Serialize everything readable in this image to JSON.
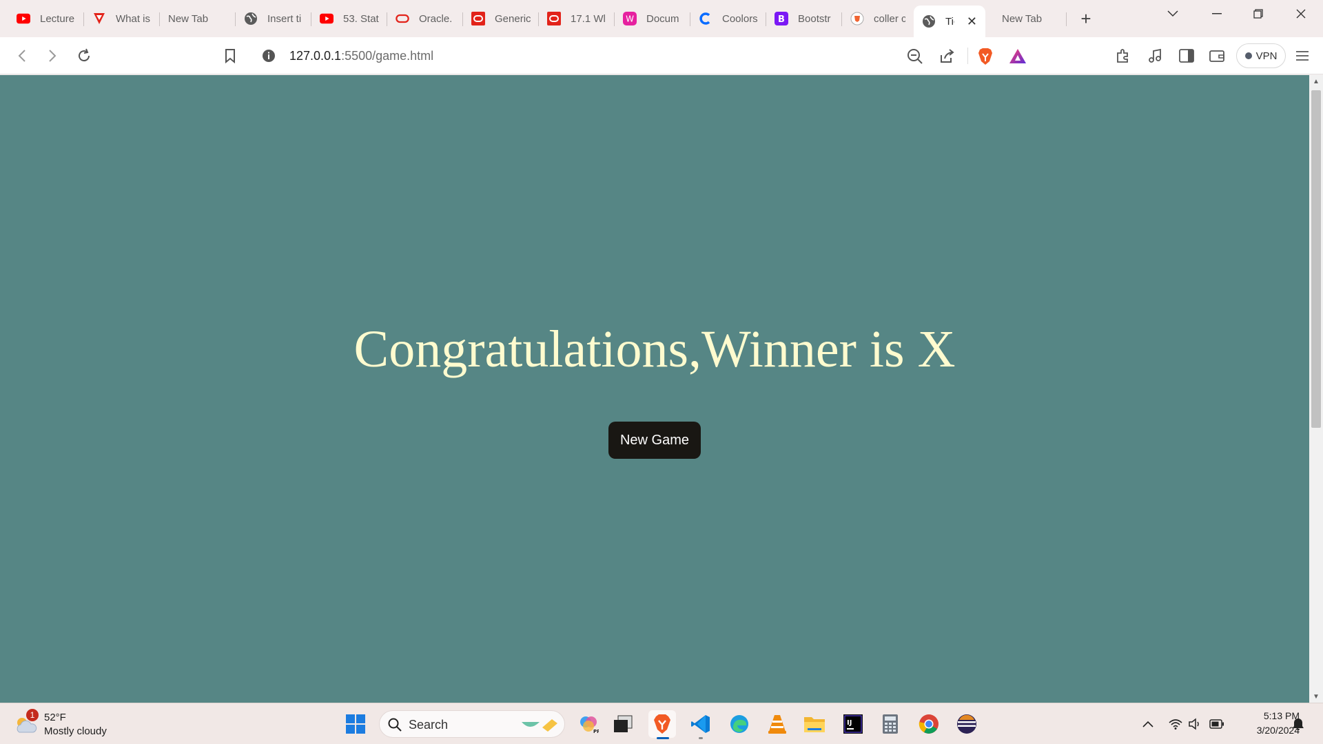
{
  "browser": {
    "tabs": [
      {
        "label": "Lecture",
        "icon": "youtube-icon"
      },
      {
        "label": "What is",
        "icon": "vivaldi-icon"
      },
      {
        "label": "New Tab",
        "icon": ""
      },
      {
        "label": "Insert ti",
        "icon": "globe-icon"
      },
      {
        "label": "53. Stat",
        "icon": "youtube-icon"
      },
      {
        "label": "Oracle.",
        "icon": "oracle-icon"
      },
      {
        "label": "Generic",
        "icon": "oracle-icon"
      },
      {
        "label": "17.1 Wl",
        "icon": "oracle-icon"
      },
      {
        "label": "Docum",
        "icon": "docs-icon"
      },
      {
        "label": "Coolors",
        "icon": "coolors-icon"
      },
      {
        "label": "Bootstr",
        "icon": "bootstrap-icon"
      },
      {
        "label": "coller c",
        "icon": "brave-shield-icon"
      },
      {
        "label": "Tic",
        "icon": "globe-icon",
        "active": true
      },
      {
        "label": "New Tab",
        "icon": ""
      }
    ],
    "address_host": "127.0.0.1",
    "address_path": ":5500/game.html",
    "vpn_label": "VPN"
  },
  "page": {
    "winner_message": "Congratulations,Winner is X",
    "new_game_label": "New Game",
    "background_color": "#568685",
    "text_color": "#fffbcf"
  },
  "taskbar": {
    "weather_temp": "52°F",
    "weather_condition": "Mostly cloudy",
    "weather_badge": "1",
    "search_label": "Search",
    "time": "5:13 PM",
    "date": "3/20/2024"
  }
}
